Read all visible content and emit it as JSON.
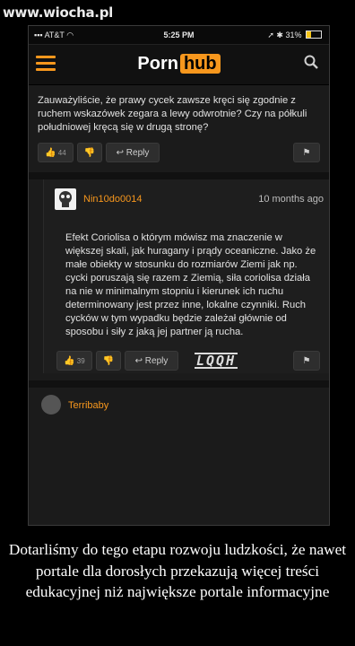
{
  "watermark": "www.wiocha.pl",
  "status_bar": {
    "carrier": "AT&T",
    "time": "5:25 PM",
    "battery": "31%",
    "battery_level": 0.31
  },
  "header": {
    "logo_left": "Porn",
    "logo_right": "hub"
  },
  "comments": [
    {
      "text": "Zauważyliście, że prawy cycek zawsze kręci się zgodnie z ruchem wskazówek zegara a lewy odwrotnie? Czy na półkuli południowej kręcą się w drugą stronę?",
      "likes": "44",
      "reply_label": "Reply"
    },
    {
      "user": "Nin10do0014",
      "time": "10 months ago",
      "text": "Efekt Coriolisa o którym mówisz ma znaczenie w większej skali, jak huragany i prądy oceaniczne. Jako że małe obiekty w stosunku do rozmiarów Ziemi jak np. cycki poruszają się razem z Ziemią, siła coriolisa działa na nie w minimalnym stopniu i kierunek ich ruchu determinowany jest przez inne, lokalne czynniki. Ruch cycków w tym wypadku będzie zależał głównie od sposobu i siły z jaką jej partner ją rucha.",
      "likes": "39",
      "reply_label": "Reply",
      "reaction": "LQQH"
    },
    {
      "user": "Terribaby"
    }
  ],
  "caption": "Dotarliśmy do tego etapu rozwoju ludzkości, że nawet portale dla dorosłych przekazują więcej treści edukacyjnej niż największe portale informacyjne"
}
